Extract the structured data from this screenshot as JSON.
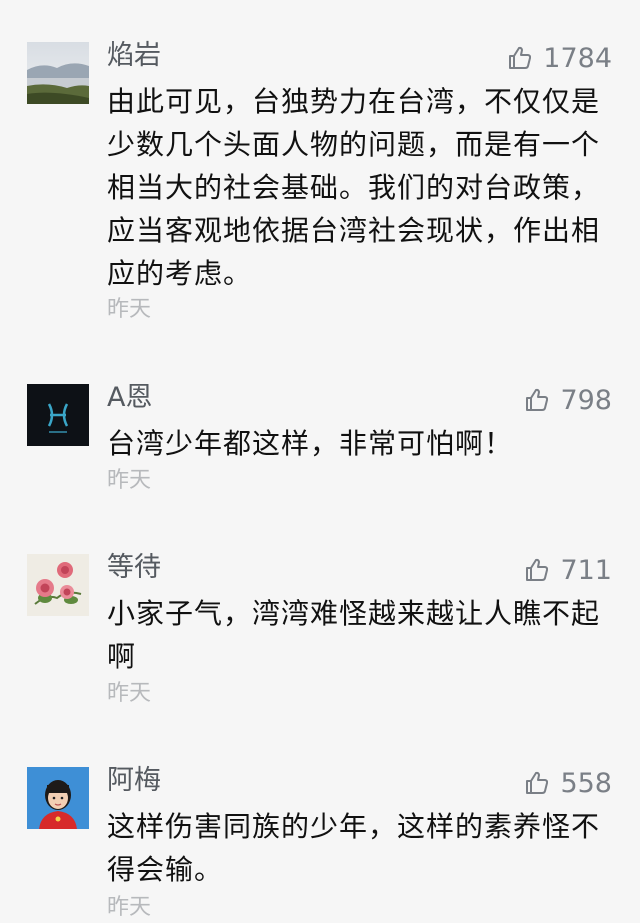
{
  "comments": [
    {
      "user": "焰岩",
      "likes": "1784",
      "text_lines": [
        "由此可见，台独势力在台湾，不仅仅是",
        "少数几个头面人物的问题，而是有一个",
        "相当大的社会基础。我们的对台政策，",
        "应当客观地依据台湾社会现状，作出相",
        "应的考虑。"
      ],
      "time": "昨天",
      "avatar_icon": "mountain-lake-photo-icon"
    },
    {
      "user": "A恩",
      "likes": "798",
      "text_lines": [
        "台湾少年都这样，非常可怕啊！"
      ],
      "time": "昨天",
      "avatar_icon": "pisces-zodiac-icon"
    },
    {
      "user": "等待",
      "likes": "711",
      "text_lines": [
        "小家子气，湾湾难怪越来越让人瞧不起",
        "啊"
      ],
      "time": "昨天",
      "avatar_icon": "peony-flower-painting-icon"
    },
    {
      "user": "阿梅",
      "likes": "558",
      "text_lines": [
        "这样伤害同族的少年，这样的素养怪不",
        "得会输。"
      ],
      "time": "昨天",
      "avatar_icon": "child-portrait-icon"
    }
  ],
  "colors": {
    "background": "#f6f6f6",
    "username": "#555a60",
    "likes": "#7a7f86",
    "time": "#b7b9bc",
    "text": "#111111"
  }
}
